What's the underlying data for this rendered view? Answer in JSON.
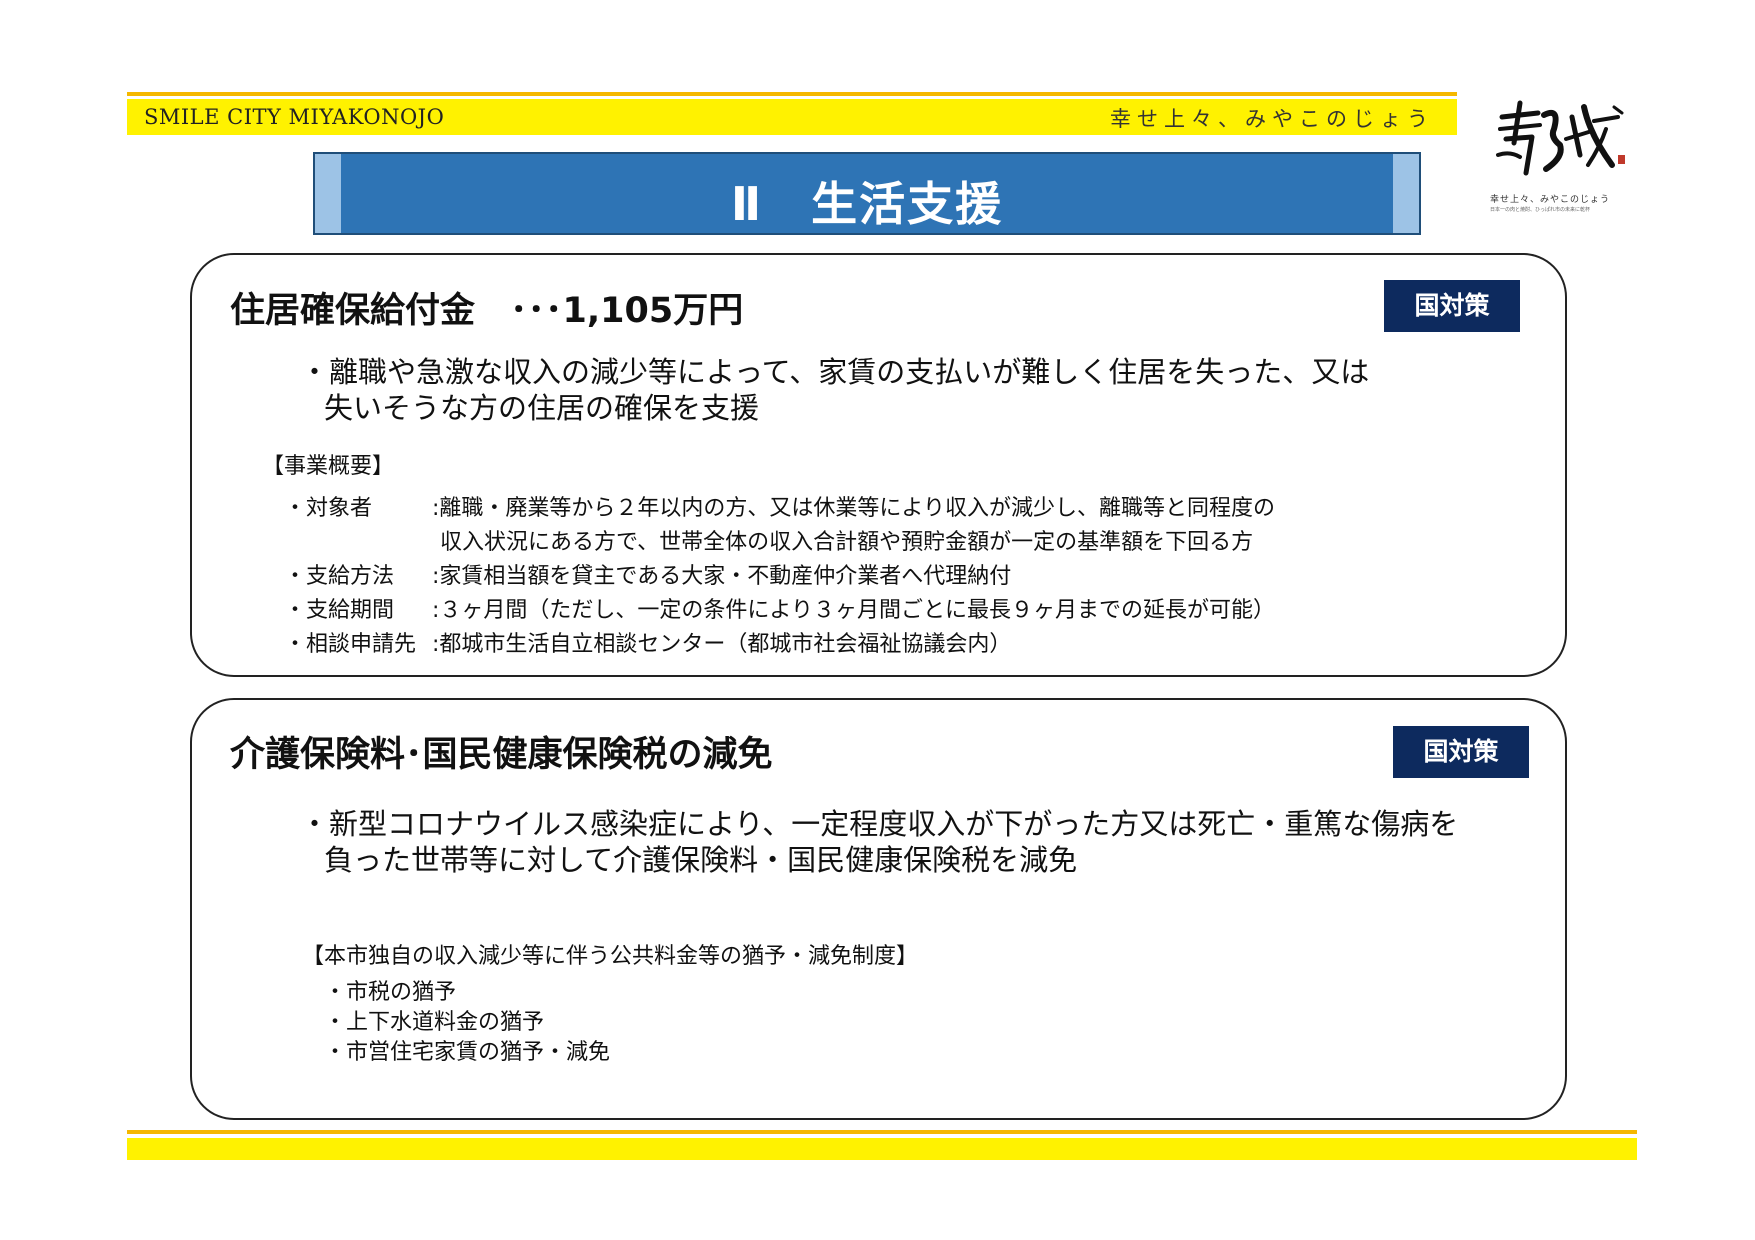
{
  "header": {
    "brand_left": "SMILE CITY MIYAKONOJO",
    "brand_right": "幸せ上々、みやこのじょう"
  },
  "logo": {
    "caption": "幸せ上々、みやこのじょう",
    "subcaption": "日本一の肉と焼酎、ひっぱれ市の未来に乾杯"
  },
  "section": {
    "title": "Ⅱ　生活支援"
  },
  "card1": {
    "title": "住居確保給付金　･･･1,105万円",
    "badge": "国対策",
    "lead_line1": "・離職や急激な収入の減少等によって、家賃の支払いが難しく住居を失った、又は",
    "lead_line2": "失いそうな方の住居の確保を支援",
    "overview_heading": "【事業概要】",
    "items": [
      {
        "label": "・対象者",
        "value": ":離職・廃業等から２年以内の方、又は休業等により収入が減少し、離職等と同程度の"
      },
      {
        "label": "",
        "value": "収入状況にある方で、世帯全体の収入合計額や預貯金額が一定の基準額を下回る方"
      },
      {
        "label": "・支給方法",
        "value": ":家賃相当額を貸主である大家・不動産仲介業者へ代理納付"
      },
      {
        "label": "・支給期間",
        "value": ":３ヶ月間（ただし、一定の条件により３ヶ月間ごとに最長９ヶ月までの延長が可能）"
      },
      {
        "label": "・相談申請先",
        "value": ":都城市生活自立相談センター（都城市社会福祉協議会内）"
      }
    ]
  },
  "card2": {
    "title": "介護保険料･国民健康保険税の減免",
    "badge": "国対策",
    "lead_line1": "・新型コロナウイルス感染症により、一定程度収入が下がった方又は死亡・重篤な傷病を",
    "lead_line2": "負った世帯等に対して介護保険料・国民健康保険税を減免",
    "system_heading": "【本市独自の収入減少等に伴う公共料金等の猶予・減免制度】",
    "items": [
      "・市税の猶予",
      "・上下水道料金の猶予",
      "・市営住宅家賃の猶予・減免"
    ]
  }
}
